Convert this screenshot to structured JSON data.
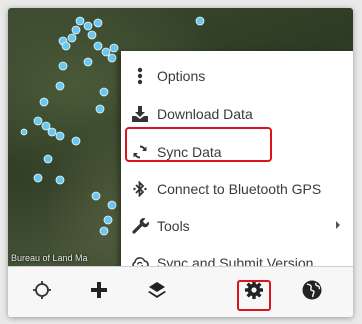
{
  "map": {
    "attribution": "Bureau of Land Ma",
    "point_color": "#6cc7ee"
  },
  "menu": {
    "items": [
      {
        "label": "Options",
        "icon": "vertical-dots-icon"
      },
      {
        "label": "Download Data",
        "icon": "download-icon"
      },
      {
        "label": "Sync Data",
        "icon": "sync-icon",
        "highlighted": true
      },
      {
        "label": "Connect to Bluetooth GPS",
        "icon": "bluetooth-icon"
      },
      {
        "label": "Tools",
        "icon": "wrench-icon",
        "has_submenu": true
      },
      {
        "label": "Sync and Submit Version",
        "icon": "cloud-sync-icon"
      }
    ]
  },
  "toolbar": {
    "buttons": [
      {
        "icon": "crosshair-icon"
      },
      {
        "icon": "plus-icon"
      },
      {
        "icon": "layers-icon"
      },
      {
        "icon": "gear-icon",
        "highlighted": true
      },
      {
        "icon": "globe-icon"
      }
    ]
  },
  "highlight_color": "#d8141e"
}
